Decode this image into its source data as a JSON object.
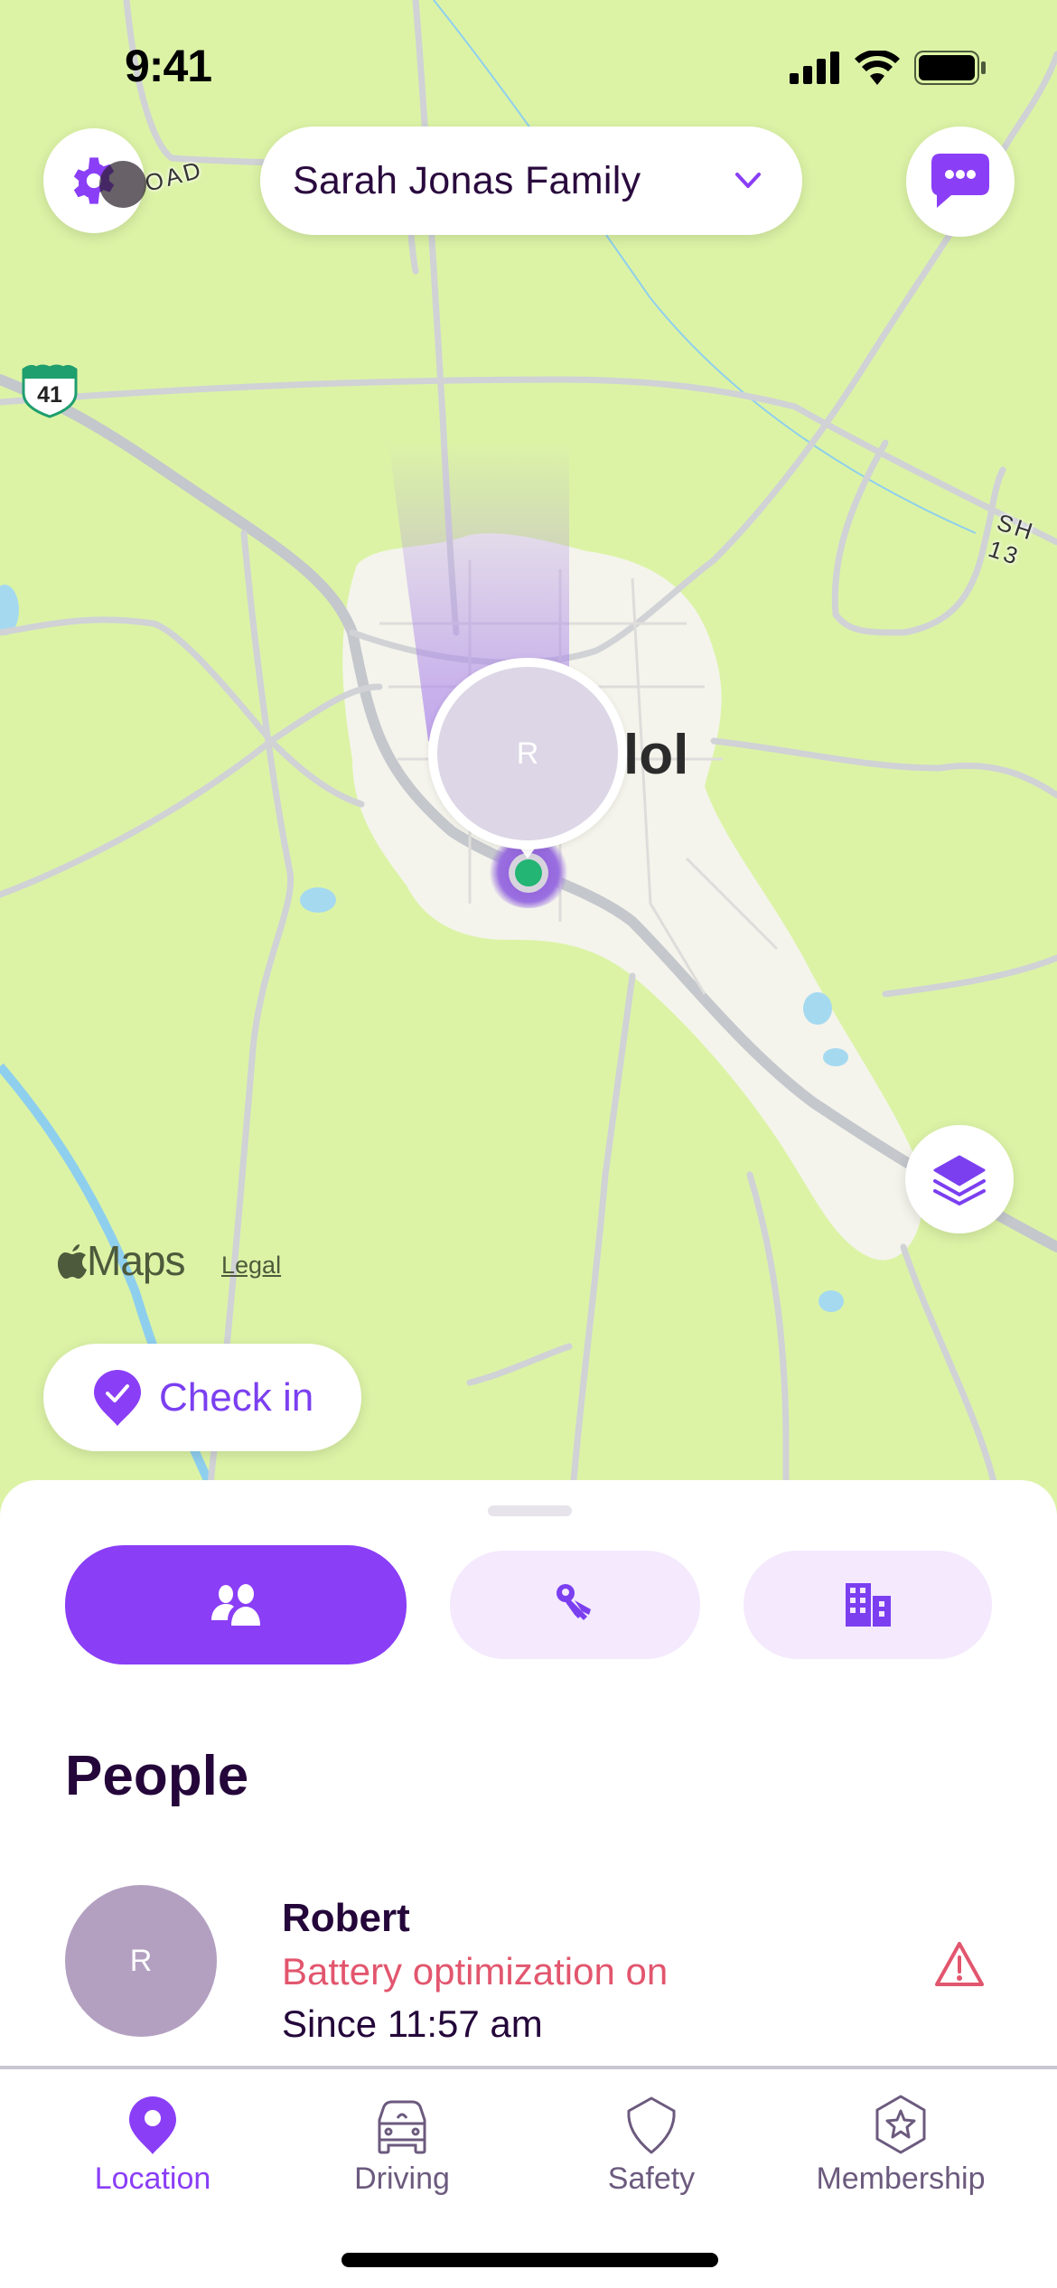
{
  "status_bar": {
    "time": "9:41",
    "icons": [
      "cellular-signal-icon",
      "wifi-icon",
      "battery-icon"
    ]
  },
  "header": {
    "settings_icon": "gear-icon",
    "family_selector": "Sarah Jonas Family",
    "family_chevron": "chevron-down-icon",
    "messages_icon": "chat-bubble-icon"
  },
  "map": {
    "town_label": "lol",
    "road_labels": [
      "OAD",
      "SH 13"
    ],
    "highway_shield": "41",
    "member_pin": {
      "initial": "R",
      "status_color": "#22b573"
    },
    "attribution": "Maps",
    "legal_link": "Legal",
    "layers_icon": "layers-icon",
    "check_in_label": "Check in"
  },
  "sheet": {
    "tabs": [
      {
        "name": "people",
        "icon": "people-icon",
        "active": true
      },
      {
        "name": "items",
        "icon": "keys-icon",
        "active": false
      },
      {
        "name": "places",
        "icon": "building-icon",
        "active": false
      }
    ],
    "section_title": "People",
    "people": [
      {
        "initial": "R",
        "name": "Robert",
        "status": "Battery optimization on",
        "since": "Since 11:57 am",
        "alert_icon": "warning-icon"
      }
    ]
  },
  "bottom_nav": {
    "items": [
      {
        "label": "Location",
        "icon": "location-pin-icon",
        "active": true
      },
      {
        "label": "Driving",
        "icon": "car-icon",
        "active": false
      },
      {
        "label": "Safety",
        "icon": "shield-icon",
        "active": false
      },
      {
        "label": "Membership",
        "icon": "star-badge-icon",
        "active": false
      }
    ]
  },
  "colors": {
    "accent": "#8a3ef6",
    "accent_light": "#f4e9fd",
    "alert": "#e2566e",
    "text_dark": "#24063a",
    "map_land": "#dcf3a6",
    "map_town": "#f4f3ef"
  }
}
